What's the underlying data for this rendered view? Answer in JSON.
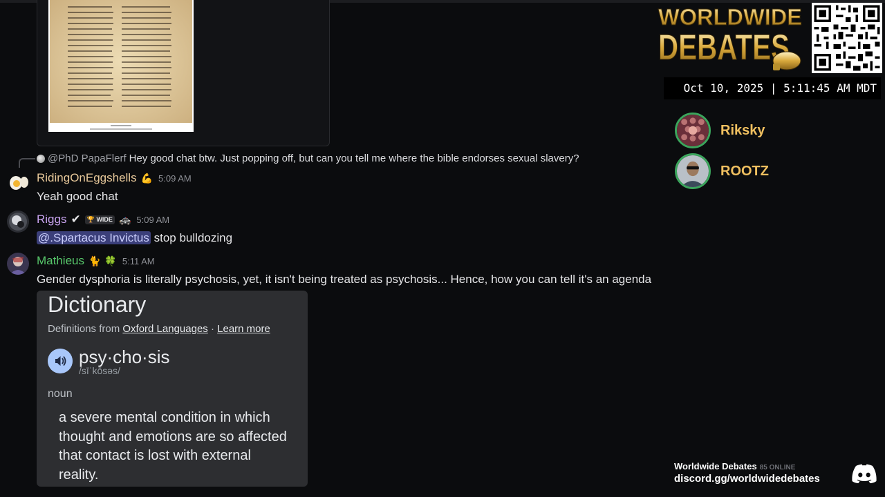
{
  "chat": {
    "reply": {
      "author": "@PhD PapaFlerf",
      "text": "Hey good chat btw.  Just popping off, but can you tell me where the bible endorses sexual slavery?"
    },
    "messages": [
      {
        "username": "RidingOnEggshells",
        "username_color": "#e7c89a",
        "badges": [
          "💪"
        ],
        "time": "5:09 AM",
        "text": "Yeah good chat"
      },
      {
        "username": "Riggs",
        "username_color": "#c9a4f0",
        "badges": [
          "✔",
          "WIDE",
          "🚓"
        ],
        "time": "5:09 AM",
        "mention": "@.Spartacus Invictus",
        "text": "stop bulldozing"
      },
      {
        "username": "Mathieus",
        "username_color": "#57c66a",
        "badges": [
          "🐈",
          "🍀"
        ],
        "time": "5:11 AM",
        "text": "Gender dysphoria is literally psychosis, yet, it isn't being treated as psychosis... Hence, how you can tell it's an agenda"
      }
    ],
    "dictionary_embed": {
      "title": "Dictionary",
      "source_prefix": "Definitions from",
      "source_name": "Oxford Languages",
      "separator": "·",
      "learn_more": "Learn more",
      "word": "psy·cho·sis",
      "phonetic": "/sīˈkōsəs/",
      "part_of_speech": "noun",
      "definition": "a severe mental condition in which thought and emotions are so affected that contact is lost with external reality."
    }
  },
  "overlay": {
    "brand_line1": "WORLDWIDE",
    "brand_line2": "DEBATES",
    "datetime": "Oct 10, 2025 | 5:11:45 AM MDT",
    "speakers": [
      {
        "name": "Riksky"
      },
      {
        "name": "ROOTZ"
      }
    ],
    "footer": {
      "server_name": "Worldwide Debates",
      "online": "85 ONLINE",
      "invite": "discord.gg/worldwidedebates"
    },
    "speaking_ring_color": "#3ba55c",
    "speaker_name_color": "#f0c060"
  }
}
